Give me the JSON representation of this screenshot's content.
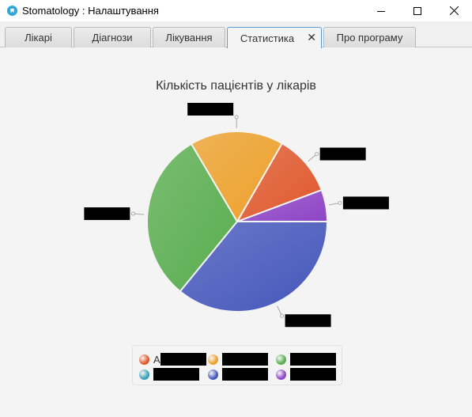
{
  "window": {
    "title": "Stomatology : Налаштування"
  },
  "tabs": [
    {
      "label": "Лікарі",
      "active": false
    },
    {
      "label": "Діагнози",
      "active": false
    },
    {
      "label": "Лікування",
      "active": false
    },
    {
      "label": "Статистика",
      "active": true,
      "closable": true
    },
    {
      "label": "Про програму",
      "active": false
    }
  ],
  "chart_data": {
    "type": "pie",
    "title": "Кількість пацієнтів у лікарів",
    "slices": [
      {
        "label": "",
        "value": 5.7,
        "color": "#8e44c6"
      },
      {
        "label": "",
        "value": 11,
        "color": "#e0572b"
      },
      {
        "label": "",
        "value": 16.8,
        "color": "#eda02a"
      },
      {
        "label": "",
        "value": 30.6,
        "color": "#58ad4e"
      },
      {
        "label": "",
        "value": 35.9,
        "color": "#4456bb"
      }
    ],
    "legend": [
      {
        "label": "А",
        "color": "#e0572b"
      },
      {
        "label": "",
        "color": "#eda02a"
      },
      {
        "label": "",
        "color": "#58ad4e"
      },
      {
        "label": "",
        "color": "#3aa0b8"
      },
      {
        "label": "",
        "color": "#4456bb"
      },
      {
        "label": "",
        "color": "#8e44c6"
      }
    ],
    "legend_placement": "bottom"
  }
}
